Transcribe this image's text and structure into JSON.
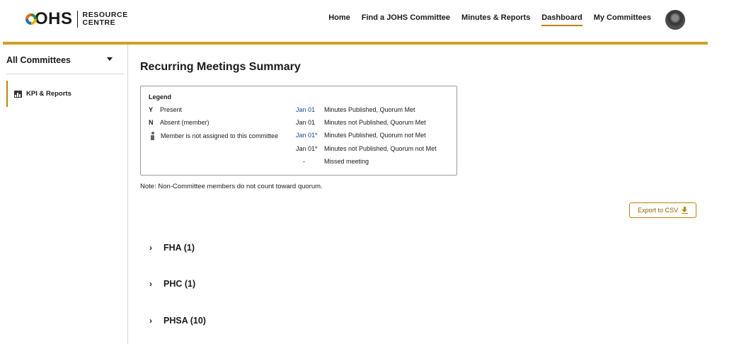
{
  "logo": {
    "brand": "OHS",
    "line1": "RESOURCE",
    "line2": "CENTRE"
  },
  "nav": {
    "items": [
      {
        "label": "Home",
        "active": false
      },
      {
        "label": "Find a JOHS Committee",
        "active": false
      },
      {
        "label": "Minutes & Reports",
        "active": false
      },
      {
        "label": "Dashboard",
        "active": true
      },
      {
        "label": "My Committees",
        "active": false
      }
    ]
  },
  "colors": {
    "accent": "#c9a227",
    "link_blue": "#1a4a8a",
    "export_text": "#8a6400"
  },
  "sidebar": {
    "dropdown_label": "All Committees",
    "items": [
      {
        "label": "KPI & Reports",
        "icon": "bar-chart-icon"
      }
    ]
  },
  "main": {
    "title": "Recurring Meetings Summary",
    "legend": {
      "title": "Legend",
      "attendance": [
        {
          "key": "Y",
          "text": "Present"
        },
        {
          "key": "N",
          "text": "Absent (member)"
        },
        {
          "icon": "person-icon",
          "text": "Member is not assigned to this committee"
        }
      ],
      "meetings": [
        {
          "date": "Jan 01",
          "text": "Minutes Published, Quorum Met",
          "blue": true
        },
        {
          "date": "Jan 01",
          "text": "Minutes not Published, Quorum Met",
          "blue": false
        },
        {
          "date": "Jan 01*",
          "text": "Minutes Published, Quorum not Met",
          "blue": true
        },
        {
          "date": "Jan 01*",
          "text": "Minutes not Published, Quorum not Met",
          "blue": false
        },
        {
          "date": "-",
          "text": "Missed meeting",
          "blue": false
        }
      ]
    },
    "note": "Note: Non-Committee members do not count toward quorum.",
    "export_label": "Export to CSV",
    "groups": [
      {
        "label": "FHA (1)"
      },
      {
        "label": "PHC (1)"
      },
      {
        "label": "PHSA (10)"
      }
    ]
  }
}
